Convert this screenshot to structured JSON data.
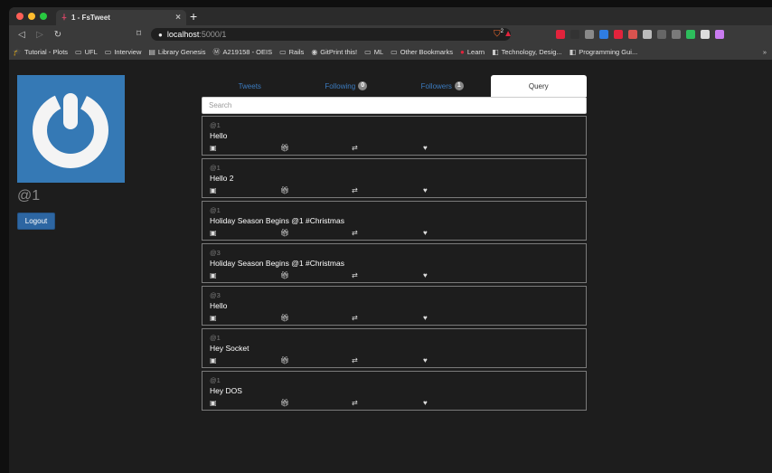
{
  "browser": {
    "tab_title": "1 - FsTweet",
    "new_tab_label": "+",
    "url_host": "localhost",
    "url_rest": ":5000/1",
    "shields_count": "2",
    "bookmarks": [
      {
        "label": "Tutorial - Plots",
        "icon": "graduation-cap-icon"
      },
      {
        "label": "UFL",
        "icon": "folder-icon"
      },
      {
        "label": "Interview",
        "icon": "folder-icon"
      },
      {
        "label": "Library Genesis",
        "icon": "book-icon"
      },
      {
        "label": "A219158 - OEIS",
        "icon": "oeis-icon"
      },
      {
        "label": "Rails",
        "icon": "folder-icon"
      },
      {
        "label": "GitPrint this!",
        "icon": "github-icon"
      },
      {
        "label": "ML",
        "icon": "folder-icon"
      },
      {
        "label": "Other Bookmarks",
        "icon": "folder-icon"
      },
      {
        "label": "Learn",
        "icon": "dot-icon"
      },
      {
        "label": "Technology, Desig...",
        "icon": "site-icon"
      },
      {
        "label": "Programming Gui...",
        "icon": "site-icon"
      }
    ],
    "bookmarks_more": "»",
    "extension_colors": [
      "#e2233c",
      "#333333",
      "#8a8a8a",
      "#2f7de1",
      "#e2233c",
      "#d9534f",
      "#bbbbbb",
      "#666666",
      "#7a7a7a",
      "#2dbd5c",
      "#dddddd",
      "#c97bf0"
    ]
  },
  "profile": {
    "handle": "@1",
    "logout_label": "Logout",
    "avatar_bg": "#3579b5"
  },
  "tabs": [
    {
      "label": "Tweets",
      "badge": ""
    },
    {
      "label": "Following",
      "badge": "0"
    },
    {
      "label": "Followers",
      "badge": "1"
    },
    {
      "label": "Query",
      "badge": ""
    }
  ],
  "search": {
    "placeholder": "Search",
    "value": ""
  },
  "tweets": [
    {
      "user": "@1",
      "text": "Hello"
    },
    {
      "user": "@1",
      "text": "Hello 2"
    },
    {
      "user": "@1",
      "text": "Holiday Season Begins @1 #Christmas"
    },
    {
      "user": "@3",
      "text": "Holiday Season Begins @1 #Christmas"
    },
    {
      "user": "@3",
      "text": "Hello"
    },
    {
      "user": "@1",
      "text": "Hey Socket"
    },
    {
      "user": "@1",
      "text": "Hey DOS"
    }
  ]
}
